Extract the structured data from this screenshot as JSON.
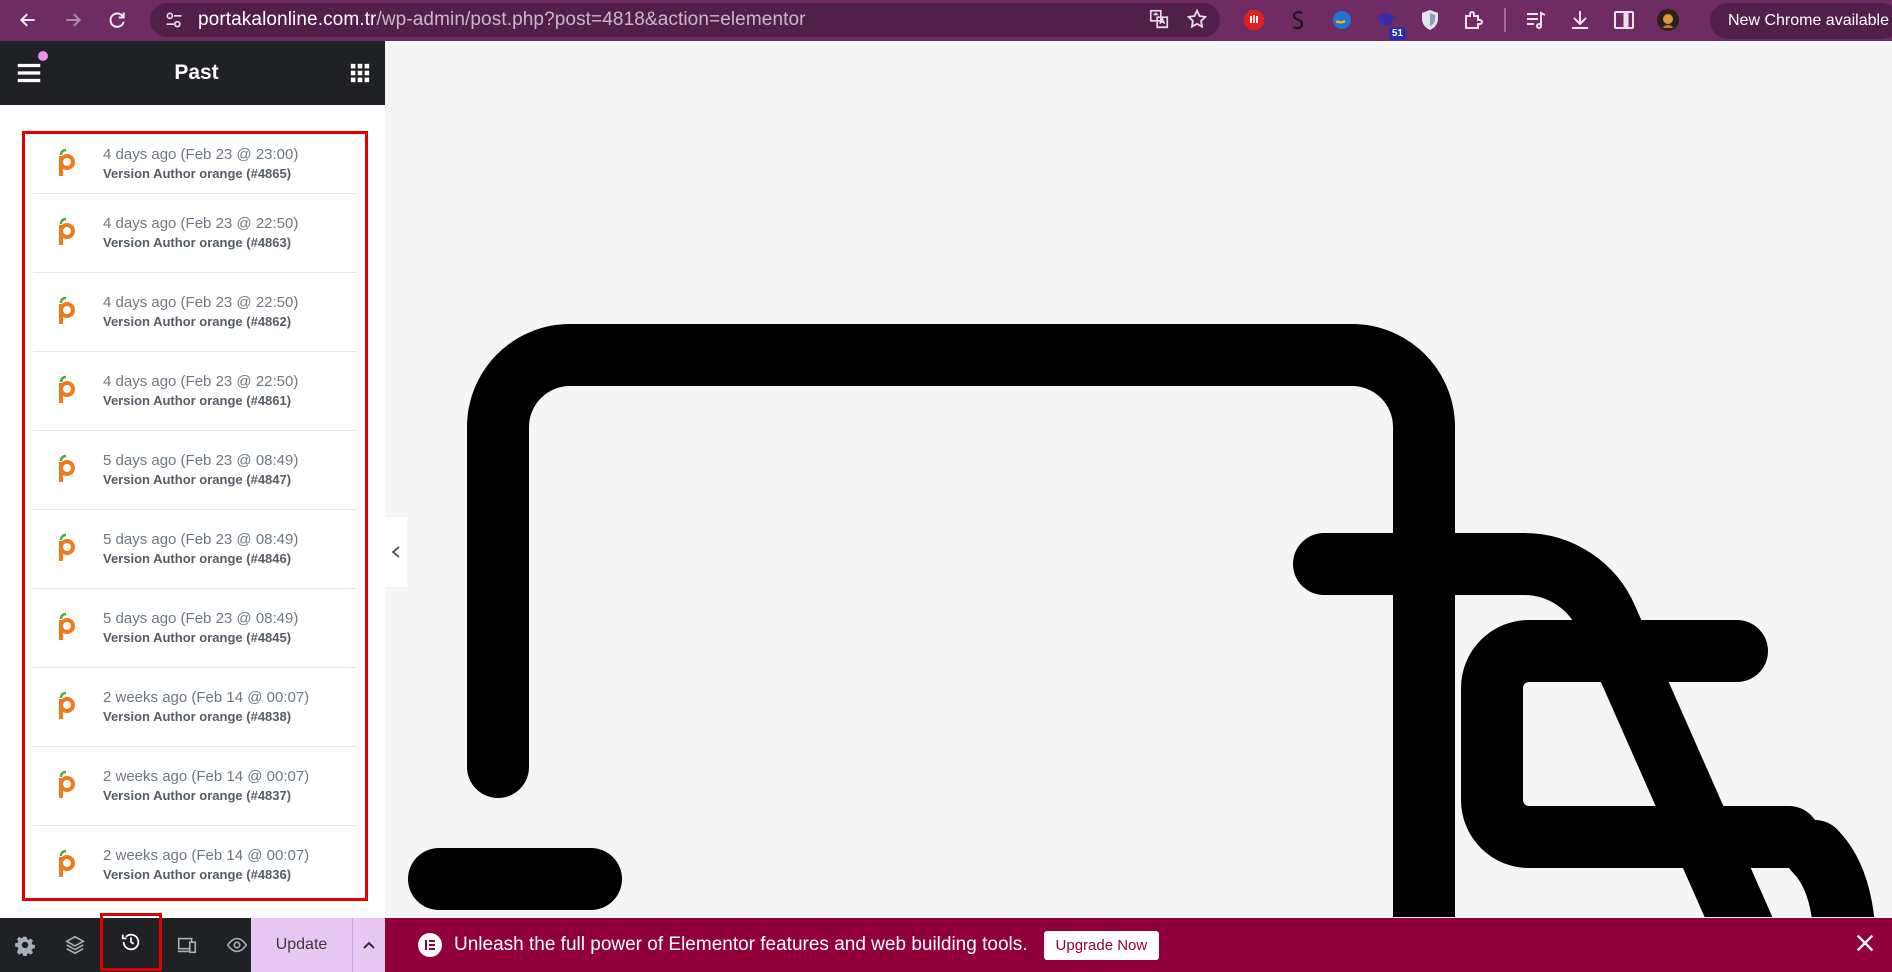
{
  "browser": {
    "url_host": "portakalonline.com.tr",
    "url_path": "/wp-admin/post.php?post=4818&action=elementor",
    "extension_badge": "51",
    "new_chrome_label": "New Chrome available"
  },
  "panel": {
    "title": "Past",
    "revisions": [
      {
        "date": "4 days ago (Feb 23 @ 23:00)",
        "author": "Version Author orange (#4865)"
      },
      {
        "date": "4 days ago (Feb 23 @ 22:50)",
        "author": "Version Author orange (#4863)"
      },
      {
        "date": "4 days ago (Feb 23 @ 22:50)",
        "author": "Version Author orange (#4862)"
      },
      {
        "date": "4 days ago (Feb 23 @ 22:50)",
        "author": "Version Author orange (#4861)"
      },
      {
        "date": "5 days ago (Feb 23 @ 08:49)",
        "author": "Version Author orange (#4847)"
      },
      {
        "date": "5 days ago (Feb 23 @ 08:49)",
        "author": "Version Author orange (#4846)"
      },
      {
        "date": "5 days ago (Feb 23 @ 08:49)",
        "author": "Version Author orange (#4845)"
      },
      {
        "date": "2 weeks ago (Feb 14 @ 00:07)",
        "author": "Version Author orange (#4838)"
      },
      {
        "date": "2 weeks ago (Feb 14 @ 00:07)",
        "author": "Version Author orange (#4837)"
      },
      {
        "date": "2 weeks ago (Feb 14 @ 00:07)",
        "author": "Version Author orange (#4836)"
      }
    ],
    "footer": {
      "update_label": "Update"
    }
  },
  "promo": {
    "text": "Unleash the full power of Elementor features and web building tools.",
    "button_label": "Upgrade Now"
  },
  "colors": {
    "browser_bar": "#6e2c63",
    "panel_header": "#1f2124",
    "highlight_border": "#e00000",
    "update_button": "#e9c7f5",
    "promo_banner": "#92003b"
  }
}
